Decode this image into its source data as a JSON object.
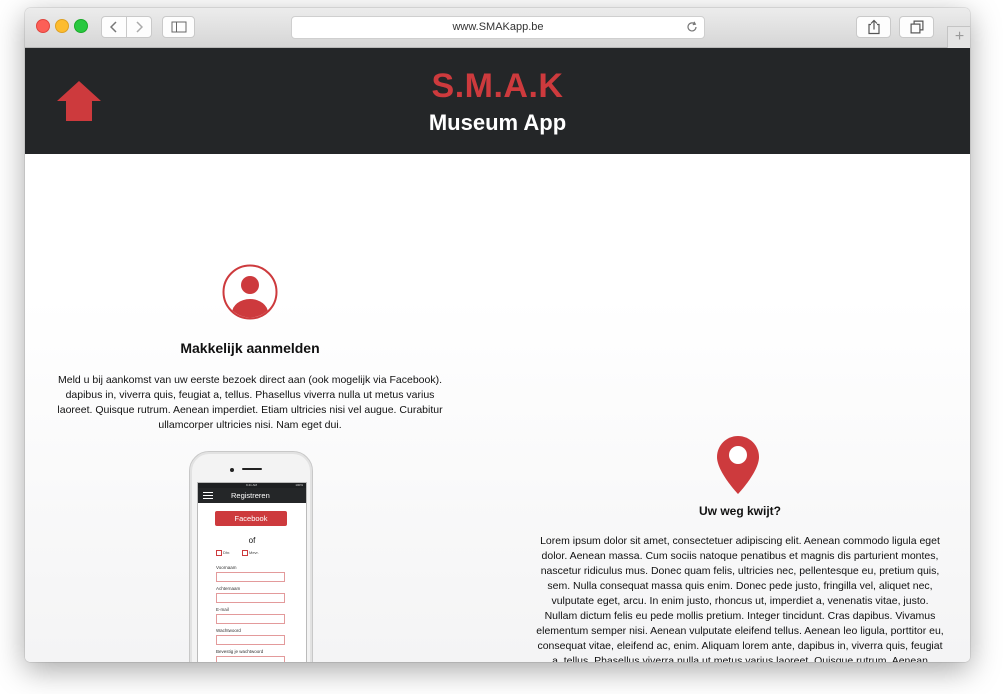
{
  "browser": {
    "url": "www.SMAKapp.be",
    "new_tab_label": "+"
  },
  "header": {
    "brand": "S.M.A.K",
    "subtitle": "Museum App"
  },
  "feature_login": {
    "title": "Makkelijk aanmelden",
    "text": "Meld u bij aankomst van uw eerste bezoek direct aan (ook mogelijk via Facebook). dapibus in, viverra quis, feugiat a, tellus. Phasellus viverra nulla ut metus varius laoreet. Quisque rutrum. Aenean imperdiet. Etiam ultricies nisi vel augue. Curabitur ullamcorper ultricies nisi. Nam eget dui."
  },
  "feature_location": {
    "title": "Uw weg kwijt?",
    "text": "Lorem ipsum dolor sit amet, consectetuer adipiscing elit. Aenean commodo ligula eget dolor. Aenean massa. Cum sociis natoque penatibus et magnis dis parturient montes, nascetur ridiculus mus. Donec quam felis, ultricies nec, pellentesque eu, pretium quis, sem. Nulla consequat massa quis enim. Donec pede justo, fringilla vel, aliquet nec, vulputate eget, arcu. In enim justo, rhoncus ut, imperdiet a, venenatis vitae, justo. Nullam dictum felis eu pede mollis pretium. Integer tincidunt. Cras dapibus. Vivamus elementum semper nisi. Aenean vulputate eleifend tellus. Aenean leo ligula, porttitor eu, consequat vitae, eleifend ac, enim. Aliquam lorem ante, dapibus in, viverra quis, feugiat a, tellus. Phasellus viverra nulla ut metus varius laoreet. Quisque rutrum. Aenean imperdiet. Etiam"
  },
  "phone_mockup": {
    "status_time": "9:41 AM",
    "status_battery": "100%",
    "app_title": "Registreren",
    "facebook_label": "Facebook",
    "or_label": "of",
    "gender_options": [
      "Dhr.",
      "Mevr."
    ],
    "fields": [
      "Voornaam",
      "Achternaam",
      "E-mail",
      "Wachtwoord",
      "Bevestig je wachtwoord"
    ]
  },
  "colors": {
    "accent": "#cd3a3d",
    "header_bg": "#242628"
  },
  "icons": {
    "home": "home-icon",
    "user": "user-icon",
    "pin": "location-pin-icon"
  }
}
